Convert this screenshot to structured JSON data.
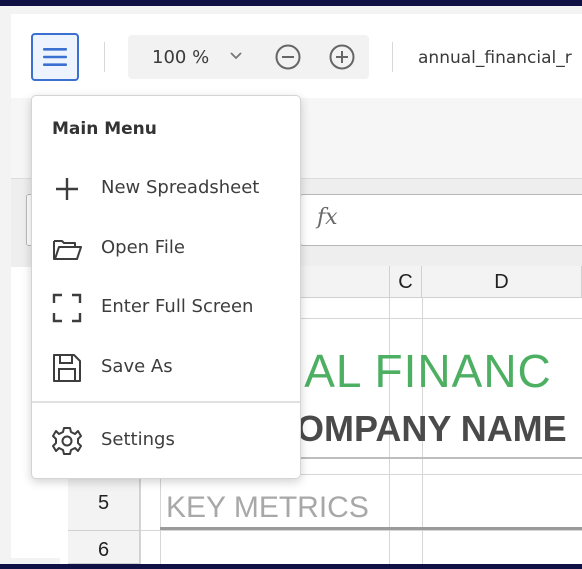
{
  "toolbar": {
    "zoom_value": "100 %",
    "filename": "annual_financial_r"
  },
  "formula_bar": {
    "fx_label": "fx"
  },
  "sheet": {
    "columns": [
      "C",
      "D"
    ],
    "rows": [
      "5",
      "6"
    ],
    "title_line1": "UAL FINANC",
    "title_line2": "OMPANY NAME",
    "section_label": "KEY METRICS"
  },
  "menu": {
    "title": "Main Menu",
    "items": [
      {
        "label": "New Spreadsheet",
        "icon": "plus-icon"
      },
      {
        "label": "Open File",
        "icon": "folder-open-icon"
      },
      {
        "label": "Enter Full Screen",
        "icon": "fullscreen-icon"
      },
      {
        "label": "Save As",
        "icon": "save-icon"
      },
      {
        "label": "Settings",
        "icon": "gear-icon"
      }
    ]
  },
  "colors": {
    "accent": "#3b6fd0",
    "title_green": "#4caf62",
    "frame": "#0f1144"
  }
}
